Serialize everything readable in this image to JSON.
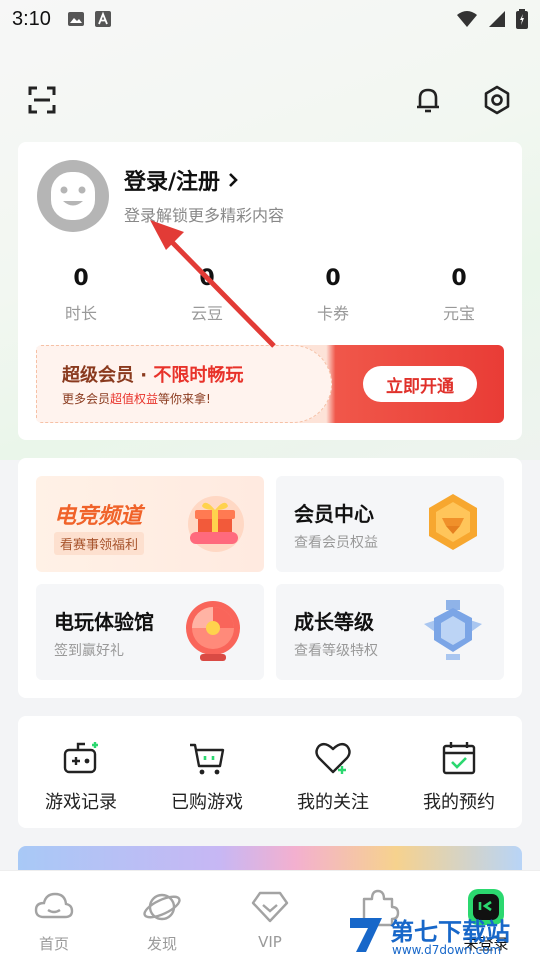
{
  "status_bar": {
    "time": "3:10"
  },
  "top_bar": {
    "icons": [
      "scan-icon",
      "bell-icon",
      "settings-icon"
    ]
  },
  "profile": {
    "login_title": "登录/注册",
    "login_subtitle": "登录解锁更多精彩内容",
    "stats": [
      {
        "value": "0",
        "label": "时长"
      },
      {
        "value": "0",
        "label": "云豆"
      },
      {
        "value": "0",
        "label": "卡券"
      },
      {
        "value": "0",
        "label": "元宝"
      }
    ]
  },
  "vip_banner": {
    "title_part1": "超级会员 · ",
    "title_part2": "不限时畅玩",
    "sub_part1": "更多会员",
    "sub_part2": "超值权益",
    "sub_part3": "等你来拿!",
    "button": "立即开通"
  },
  "features": [
    {
      "title": "电竞频道",
      "subtitle": "看赛事领福利"
    },
    {
      "title": "会员中心",
      "subtitle": "查看会员权益"
    },
    {
      "title": "电玩体验馆",
      "subtitle": "签到赢好礼"
    },
    {
      "title": "成长等级",
      "subtitle": "查看等级特权"
    }
  ],
  "quick_entries": [
    {
      "label": "游戏记录",
      "icon": "gamepad-icon"
    },
    {
      "label": "已购游戏",
      "icon": "cart-icon"
    },
    {
      "label": "我的关注",
      "icon": "heart-icon"
    },
    {
      "label": "我的预约",
      "icon": "calendar-icon"
    }
  ],
  "bottom_nav": [
    {
      "label": "首页",
      "icon": "cloud-icon"
    },
    {
      "label": "发现",
      "icon": "planet-icon"
    },
    {
      "label": "VIP",
      "icon": "diamond-icon"
    },
    {
      "label": "",
      "icon": "puzzle-icon"
    },
    {
      "label": "未登录",
      "icon": "avatar-icon"
    }
  ],
  "watermark": {
    "text": "第七下载站",
    "url": "www.d7down.com"
  },
  "colors": {
    "accent_red": "#e8322a",
    "esports_orange": "#f0632a",
    "nav_active_green": "#2bd86f"
  }
}
